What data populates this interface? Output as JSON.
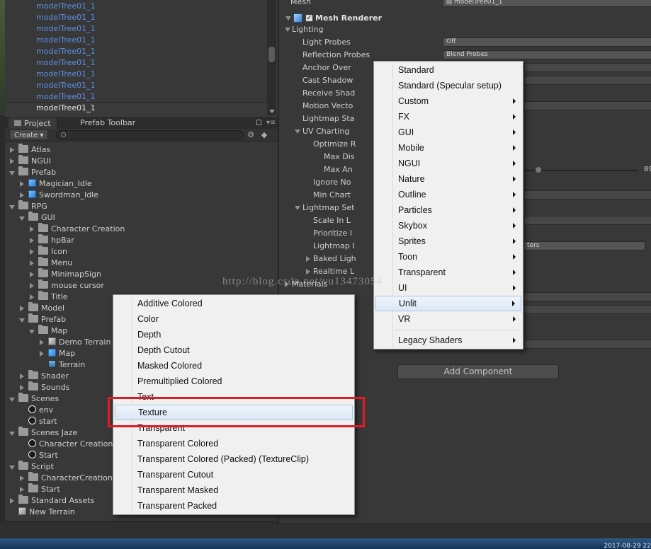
{
  "hierarchy": {
    "items": [
      "modelTree01_1",
      "modelTree01_1",
      "modelTree01_1",
      "modelTree01_1",
      "modelTree01_1",
      "modelTree01_1",
      "modelTree01_1",
      "modelTree01_1",
      "modelTree01_1",
      "modelTree01_1"
    ],
    "selected_index": 9
  },
  "project": {
    "tabs": [
      "Project",
      "Prefab Toolbar"
    ],
    "create_label": "Create",
    "tree": [
      {
        "label": "Atlas",
        "depth": 0,
        "icon": "folder",
        "expanded": false
      },
      {
        "label": "NGUI",
        "depth": 0,
        "icon": "folder",
        "expanded": false
      },
      {
        "label": "Prefab",
        "depth": 0,
        "icon": "folder",
        "expanded": true
      },
      {
        "label": "Magician_Idle",
        "depth": 1,
        "icon": "prefab",
        "expanded": false
      },
      {
        "label": "Swordman_Idle",
        "depth": 1,
        "icon": "prefab",
        "expanded": false
      },
      {
        "label": "RPG",
        "depth": 0,
        "icon": "folder",
        "expanded": true
      },
      {
        "label": "GUI",
        "depth": 1,
        "icon": "folder",
        "expanded": true
      },
      {
        "label": "Character Creation",
        "depth": 2,
        "icon": "folder",
        "expanded": false
      },
      {
        "label": "hpBar",
        "depth": 2,
        "icon": "folder",
        "expanded": false
      },
      {
        "label": "Icon",
        "depth": 2,
        "icon": "folder",
        "expanded": false
      },
      {
        "label": "Menu",
        "depth": 2,
        "icon": "folder",
        "expanded": false
      },
      {
        "label": "MinimapSign",
        "depth": 2,
        "icon": "folder",
        "expanded": false
      },
      {
        "label": "mouse cursor",
        "depth": 2,
        "icon": "folder",
        "expanded": false
      },
      {
        "label": "Title",
        "depth": 2,
        "icon": "folder",
        "expanded": false
      },
      {
        "label": "Model",
        "depth": 1,
        "icon": "folder",
        "expanded": false
      },
      {
        "label": "Prefab",
        "depth": 1,
        "icon": "folder",
        "expanded": true
      },
      {
        "label": "Map",
        "depth": 2,
        "icon": "folder",
        "expanded": true
      },
      {
        "label": "Demo Terrain",
        "depth": 3,
        "icon": "prefab-grey",
        "expanded": false
      },
      {
        "label": "Map",
        "depth": 3,
        "icon": "prefab",
        "expanded": false
      },
      {
        "label": "Terrain",
        "depth": 3,
        "icon": "terrain",
        "leaf": true
      },
      {
        "label": "Shader",
        "depth": 1,
        "icon": "folder",
        "expanded": false
      },
      {
        "label": "Sounds",
        "depth": 1,
        "icon": "folder",
        "expanded": false
      },
      {
        "label": "Scenes",
        "depth": 0,
        "icon": "folder",
        "expanded": true
      },
      {
        "label": "env",
        "depth": 1,
        "icon": "unity-scene",
        "leaf": true
      },
      {
        "label": "start",
        "depth": 1,
        "icon": "unity-scene",
        "leaf": true
      },
      {
        "label": "Scenes Jaze",
        "depth": 0,
        "icon": "folder",
        "expanded": true
      },
      {
        "label": "Character Creation",
        "depth": 1,
        "icon": "unity-scene",
        "leaf": true
      },
      {
        "label": "Start",
        "depth": 1,
        "icon": "unity-scene",
        "leaf": true
      },
      {
        "label": "Script",
        "depth": 0,
        "icon": "folder",
        "expanded": true
      },
      {
        "label": "CharacterCreation",
        "depth": 1,
        "icon": "folder",
        "expanded": false
      },
      {
        "label": "Start",
        "depth": 1,
        "icon": "folder",
        "expanded": false
      },
      {
        "label": "Standard Assets",
        "depth": 0,
        "icon": "folder",
        "expanded": false
      },
      {
        "label": "New Terrain",
        "depth": 0,
        "icon": "prefab-grey",
        "leaf": true
      }
    ]
  },
  "inspector": {
    "mesh_label": "Mesh",
    "mesh_value": "modelTree01_1",
    "component_title": "Mesh Renderer",
    "lighting_label": "Lighting",
    "light_probes_label": "Light Probes",
    "light_probes_value": "Off",
    "reflection_probes_label": "Reflection Probes",
    "reflection_probes_value": "Blend Probes",
    "anchor_override": "Anchor Over",
    "cast_shadows": "Cast Shadow",
    "receive_shadows": "Receive Shad",
    "motion_vectors": "Motion Vecto",
    "lightmap_static": "Lightmap Sta",
    "uv_charting": "UV Charting",
    "optimize": "Optimize R",
    "max_dist": "Max Dis",
    "max_angle": "Max An",
    "slider_value": "89",
    "ignore_normals": "Ignore No",
    "min_chart": "Min Chart",
    "lightmap_settings": "Lightmap Set",
    "scale_in_lightmap": "Scale In L",
    "prioritize": "Prioritize I",
    "lightmap_params": "Lightmap I",
    "lightmap_params_value": "ters",
    "baked_lightmap": "Baked Ligh",
    "realtime_lightmap": "Realtime L",
    "materials": "Materials",
    "add_component": "Add Component"
  },
  "shader_menu": {
    "items": [
      "Standard",
      "Standard (Specular setup)",
      "Custom",
      "FX",
      "GUI",
      "Mobile",
      "NGUI",
      "Nature",
      "Outline",
      "Particles",
      "Skybox",
      "Sprites",
      "Toon",
      "Transparent",
      "UI",
      "Unlit",
      "VR",
      "Legacy Shaders"
    ],
    "submenu_flags": [
      false,
      false,
      true,
      true,
      true,
      true,
      true,
      true,
      true,
      true,
      true,
      true,
      true,
      true,
      true,
      true,
      true,
      true
    ],
    "highlighted": "Unlit"
  },
  "unlit_menu": {
    "items": [
      "Additive Colored",
      "Color",
      "Depth",
      "Depth Cutout",
      "Masked Colored",
      "Premultiplied Colored",
      "Text",
      "Texture",
      "Transparent",
      "Transparent Colored",
      "Transparent Colored (Packed) (TextureClip)",
      "Transparent Cutout",
      "Transparent Masked",
      "Transparent Packed"
    ],
    "highlighted": "Texture"
  },
  "watermark": "http://blog.csdn.net/yu13473054",
  "taskbar_clock": "2017-08-29  22",
  "colors": {
    "highlight_box": "#e11b22",
    "hierarchy_text": "#5b8fe6",
    "menu_bg": "#f0f0f0"
  }
}
